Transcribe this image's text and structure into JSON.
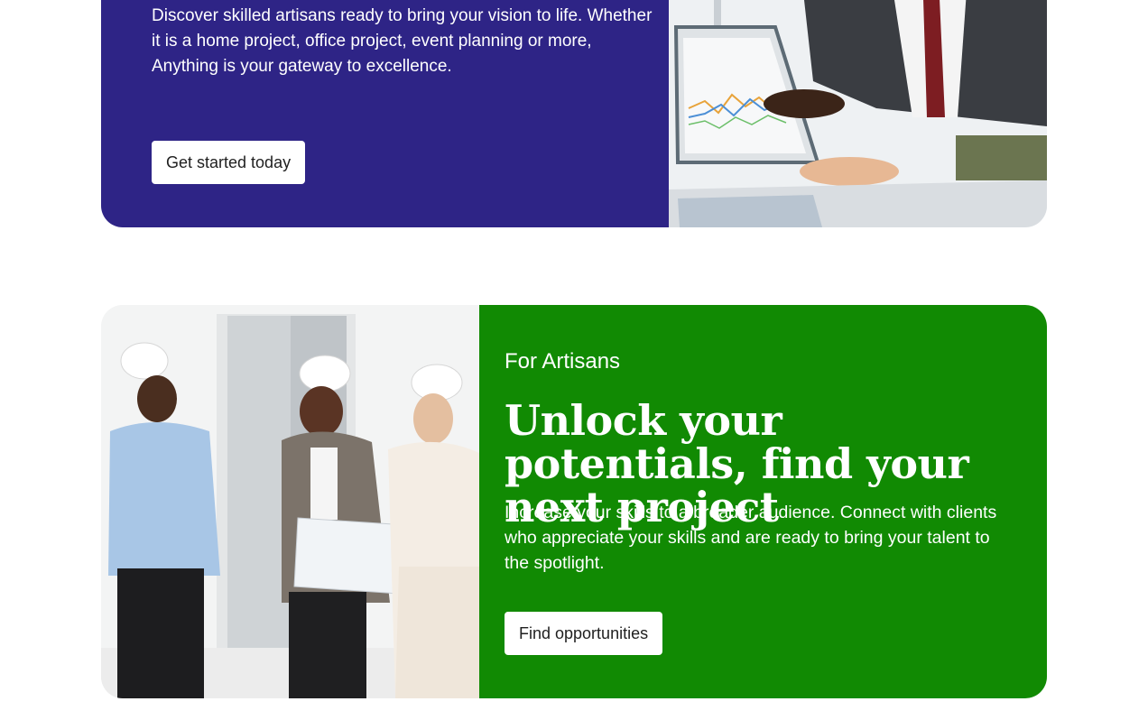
{
  "clients_section": {
    "description": "Discover skilled artisans ready to bring your vision to life. Whether it is a home project, office project, event planning or more, Anything is your gateway to excellence.",
    "cta_label": "Get started today",
    "background_color": "#2e2486",
    "photo_subject": "business-meeting-chart-photo"
  },
  "artisans_section": {
    "eyebrow": "For Artisans",
    "headline": "Unlock your potentials, find your next project",
    "description": "Increase your skills to a broader audience. Connect with clients who appreciate your skills and are ready to bring your talent to the spotlight.",
    "cta_label": "Find opportunities",
    "background_color": "#118a03",
    "photo_subject": "construction-workers-hardhats-photo"
  }
}
